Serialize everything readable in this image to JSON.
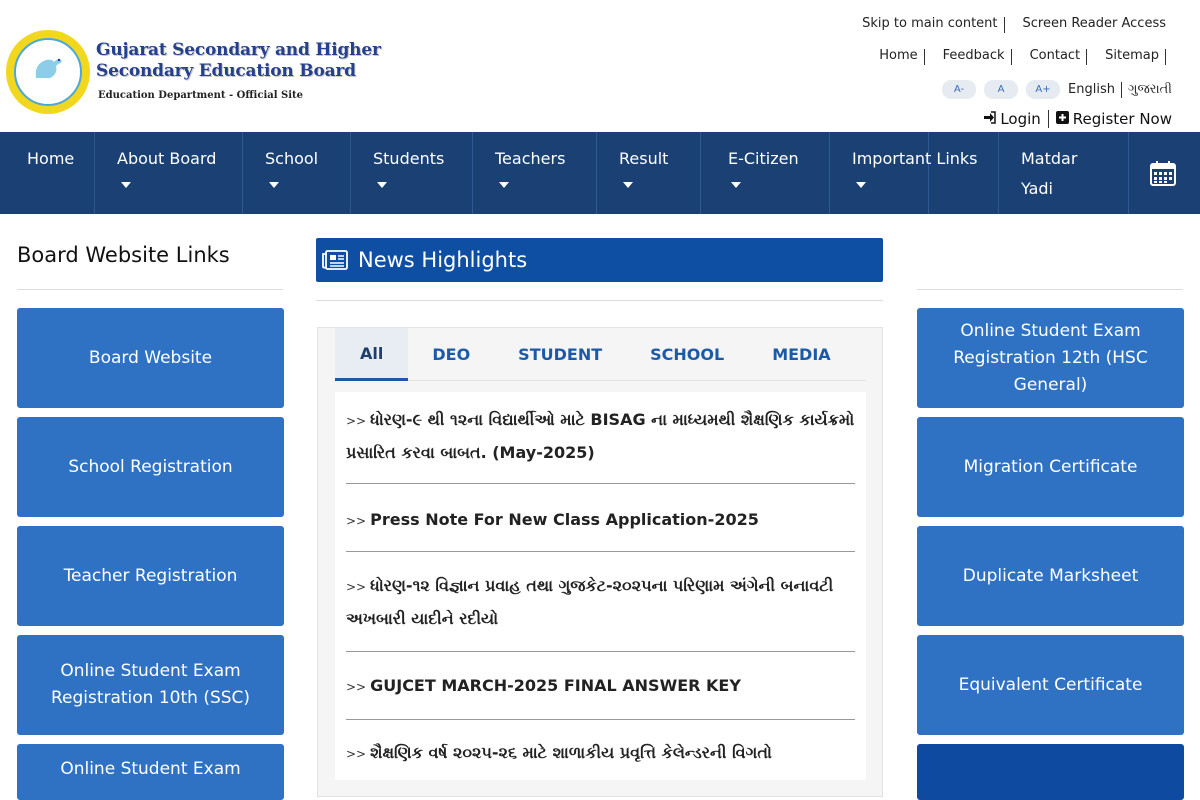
{
  "header": {
    "org_line1": "Gujarat Secondary and Higher",
    "org_line2": "Secondary Education Board",
    "org_sub": "Education Department - Official Site",
    "skip_link": "Skip to main content",
    "screen_reader": "Screen Reader Access",
    "links": [
      "Home",
      "Feedback",
      "Contact",
      "Sitemap"
    ],
    "font_small": "A-",
    "font_normal": "A",
    "font_large": "A+",
    "lang_en": "English",
    "lang_gu": "ગુજરાતી",
    "login": "Login",
    "register": "Register Now"
  },
  "nav": {
    "items": [
      {
        "label": "Home"
      },
      {
        "label": "About Board"
      },
      {
        "label": "School"
      },
      {
        "label": "Students"
      },
      {
        "label": "Teachers"
      },
      {
        "label": "Result"
      },
      {
        "label": "E-Citizen"
      },
      {
        "label": "Important Links"
      },
      {
        "label": "Matdar Yadi"
      }
    ]
  },
  "left": {
    "title": "Board Website Links",
    "tiles": [
      "Board Website",
      "School Registration",
      "Teacher Registration",
      "Online Student Exam Registration 10th (SSC)",
      "Online Student Exam"
    ]
  },
  "news": {
    "title": "News Highlights",
    "tabs": [
      "All",
      "DEO",
      "STUDENT",
      "SCHOOL",
      "MEDIA"
    ],
    "prefix": ">>",
    "items": [
      "ધોરણ-૯ થી ૧૨ના વિદ્યાર્થીઓ માટે BISAG ના માધ્યમથી શૈક્ષણિક કાર્યક્રમો પ્રસારિત કરવા બાબત. (May-2025)",
      "Press Note For New Class Application-2025",
      "ધોરણ-૧૨ વિજ્ઞાન પ્રવાહ તથા ગુજકેટ-૨૦૨૫ના પરિણામ અંગેની બનાવટી અખબારી યાદીને રદીયો",
      "GUJCET MARCH-2025 FINAL ANSWER KEY",
      "શૈક્ષણિક વર્ષ ૨૦૨૫-૨૬ માટે શાળાકીય પ્રવૃત્તિ કેલેન્ડરની વિગતો"
    ]
  },
  "right": {
    "tiles": [
      "Online Student Exam Registration 12th (HSC General)",
      "Migration Certificate",
      "Duplicate Marksheet",
      "Equivalent Certificate"
    ]
  },
  "colors": {
    "nav_bg": "#1a4074",
    "tile_bg": "#2f72c4",
    "news_bar": "#0e4fa3",
    "tab_text": "#1c5aa8"
  }
}
